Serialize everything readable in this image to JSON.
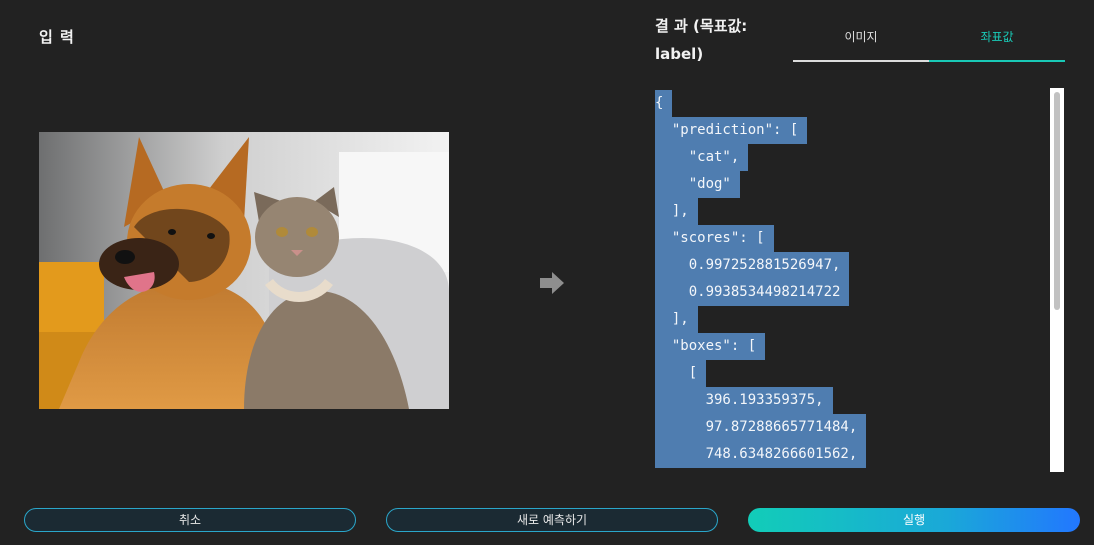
{
  "input": {
    "title": "입 력"
  },
  "result": {
    "title": "결 과 (목표값: label)"
  },
  "tabs": [
    {
      "label": "이미지"
    },
    {
      "label": "좌표값"
    }
  ],
  "json_lines": [
    "{",
    "  \"prediction\": [",
    "    \"cat\",",
    "    \"dog\"",
    "  ],",
    "  \"scores\": [",
    "    0.997252881526947,",
    "    0.9938534498214722",
    "  ],",
    "  \"boxes\": [",
    "    [",
    "      396.193359375,",
    "      97.87288665771484,",
    "      748.6348266601562,"
  ],
  "buttons": {
    "cancel": "취소",
    "reset": "새로 예측하기",
    "run": "실행"
  },
  "colors": {
    "accent": "#19c9b6",
    "selection": "#4f7db0",
    "background": "#222222"
  }
}
